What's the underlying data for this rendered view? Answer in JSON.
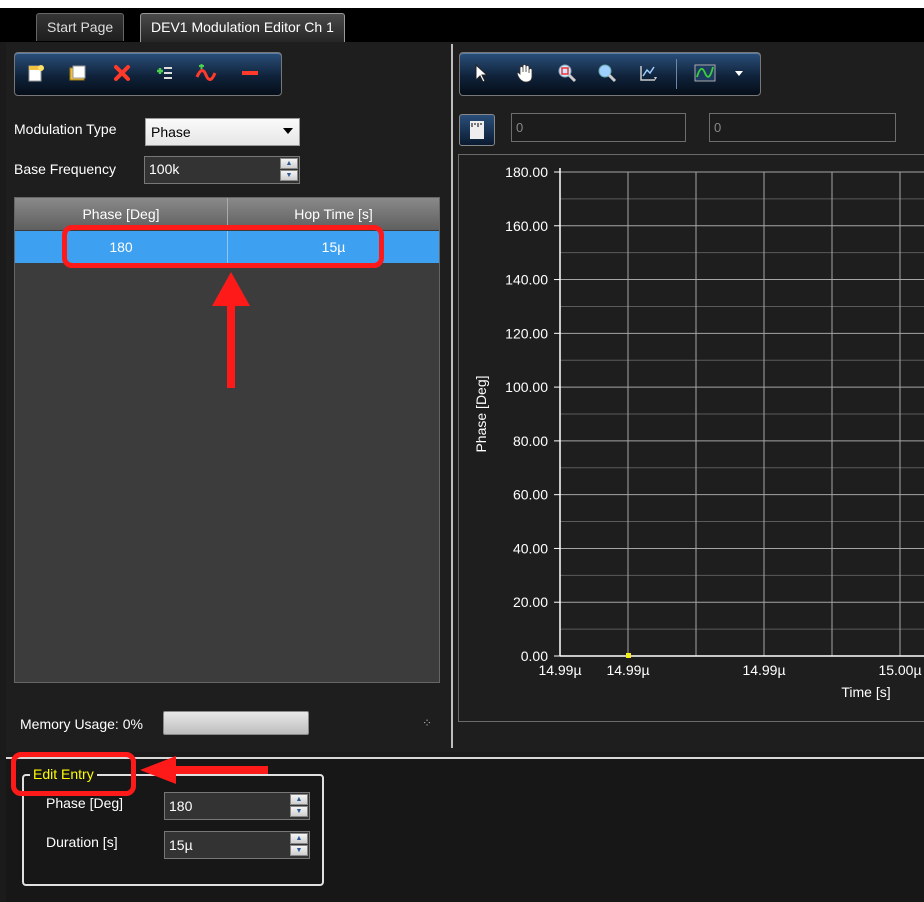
{
  "tabs": [
    {
      "label": "Start Page"
    },
    {
      "label": "DEV1 Modulation Editor Ch 1"
    }
  ],
  "left_toolbar": {
    "icons": [
      "new-icon",
      "open-icon",
      "delete-icon",
      "insert-row-icon",
      "waveform-icon",
      "remove-icon"
    ]
  },
  "form": {
    "modulation_type_label": "Modulation Type",
    "modulation_type_value": "Phase",
    "base_frequency_label": "Base Frequency",
    "base_frequency_value": "100k"
  },
  "table": {
    "headers": [
      "Phase [Deg]",
      "Hop Time [s]"
    ],
    "rows": [
      {
        "phase": "180",
        "hop_time": "15µ"
      }
    ]
  },
  "memory": {
    "label": "Memory Usage: 0%",
    "fraction": 0
  },
  "chart_toolbar": {
    "icons": [
      "pointer-icon",
      "pan-hand-icon",
      "zoom-box-icon",
      "zoom-icon",
      "zoom-fit-icon",
      "chart-style-icon",
      "dropdown-arrow-icon"
    ]
  },
  "cursor_fields": {
    "field1": "0",
    "field2": "0"
  },
  "chart_data": {
    "type": "scatter",
    "ylabel": "Phase [Deg]",
    "xlabel": "Time [s]",
    "ylim": [
      0,
      180
    ],
    "y_ticks": [
      "180.00",
      "160.00",
      "140.00",
      "120.00",
      "100.00",
      "80.00",
      "60.00",
      "40.00",
      "20.00",
      "0.00"
    ],
    "x_tick_labels": [
      "14.99µ",
      "14.99µ",
      "14.99µ",
      "15.00µ"
    ],
    "points": [
      {
        "x": "14.99µ",
        "y": 0
      }
    ],
    "grid": true,
    "point_color": "#f2ee1a"
  },
  "edit_entry": {
    "title": "Edit Entry",
    "phase_label": "Phase [Deg]",
    "phase_value": "180",
    "duration_label": "Duration [s]",
    "duration_value": "15µ"
  },
  "colors": {
    "selection": "#3ea0f0",
    "annotation": "#ff1a1a",
    "group_title": "#ffff00"
  }
}
